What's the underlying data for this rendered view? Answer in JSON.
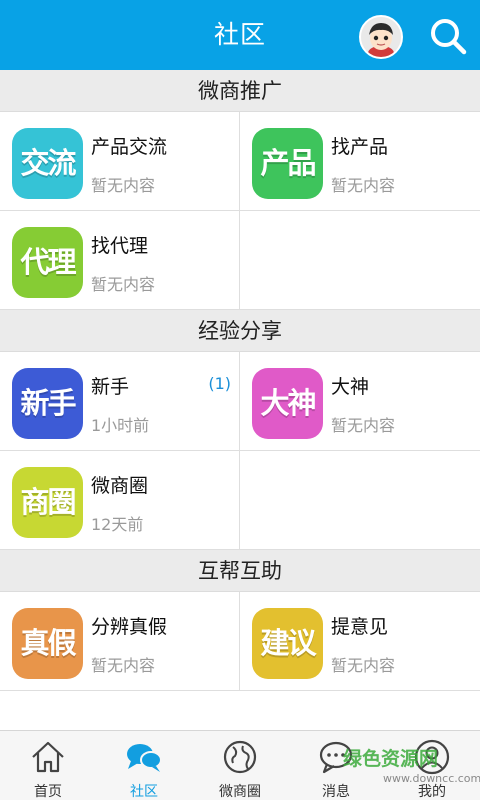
{
  "header": {
    "title": "社区",
    "color": "#08a2e6"
  },
  "sections": [
    {
      "title": "微商推广",
      "items": [
        {
          "icon_text": "交流",
          "icon_color": "#35c3d6",
          "title": "产品交流",
          "subtitle": "暂无内容",
          "badge": ""
        },
        {
          "icon_text": "产品",
          "icon_color": "#3ec45c",
          "title": "找产品",
          "subtitle": "暂无内容",
          "badge": ""
        },
        {
          "icon_text": "代理",
          "icon_color": "#86cc34",
          "title": "找代理",
          "subtitle": "暂无内容",
          "badge": ""
        }
      ]
    },
    {
      "title": "经验分享",
      "items": [
        {
          "icon_text": "新手",
          "icon_color": "#3d5bd6",
          "title": "新手",
          "subtitle": "1小时前",
          "badge": "(1)"
        },
        {
          "icon_text": "大神",
          "icon_color": "#e05ac8",
          "title": "大神",
          "subtitle": "暂无内容",
          "badge": ""
        },
        {
          "icon_text": "商圈",
          "icon_color": "#c7d833",
          "title": "微商圈",
          "subtitle": "12天前",
          "badge": ""
        }
      ]
    },
    {
      "title": "互帮互助",
      "items": [
        {
          "icon_text": "真假",
          "icon_color": "#e8954a",
          "title": "分辨真假",
          "subtitle": "暂无内容",
          "badge": ""
        },
        {
          "icon_text": "建议",
          "icon_color": "#e3c02f",
          "title": "提意见",
          "subtitle": "暂无内容",
          "badge": ""
        }
      ]
    }
  ],
  "tabs": [
    {
      "label": "首页",
      "icon": "home-icon",
      "active": false
    },
    {
      "label": "社区",
      "icon": "chat-bubbles-icon",
      "active": true
    },
    {
      "label": "微商圈",
      "icon": "globe-icon",
      "active": false
    },
    {
      "label": "消息",
      "icon": "message-icon",
      "active": false
    },
    {
      "label": "我的",
      "icon": "person-icon",
      "active": false
    }
  ],
  "watermark": {
    "text": "绿色资源网",
    "url_text": "www.downcc.com"
  },
  "colors": {
    "active_tab": "#129ee0",
    "badge": "#1a8fd8"
  }
}
